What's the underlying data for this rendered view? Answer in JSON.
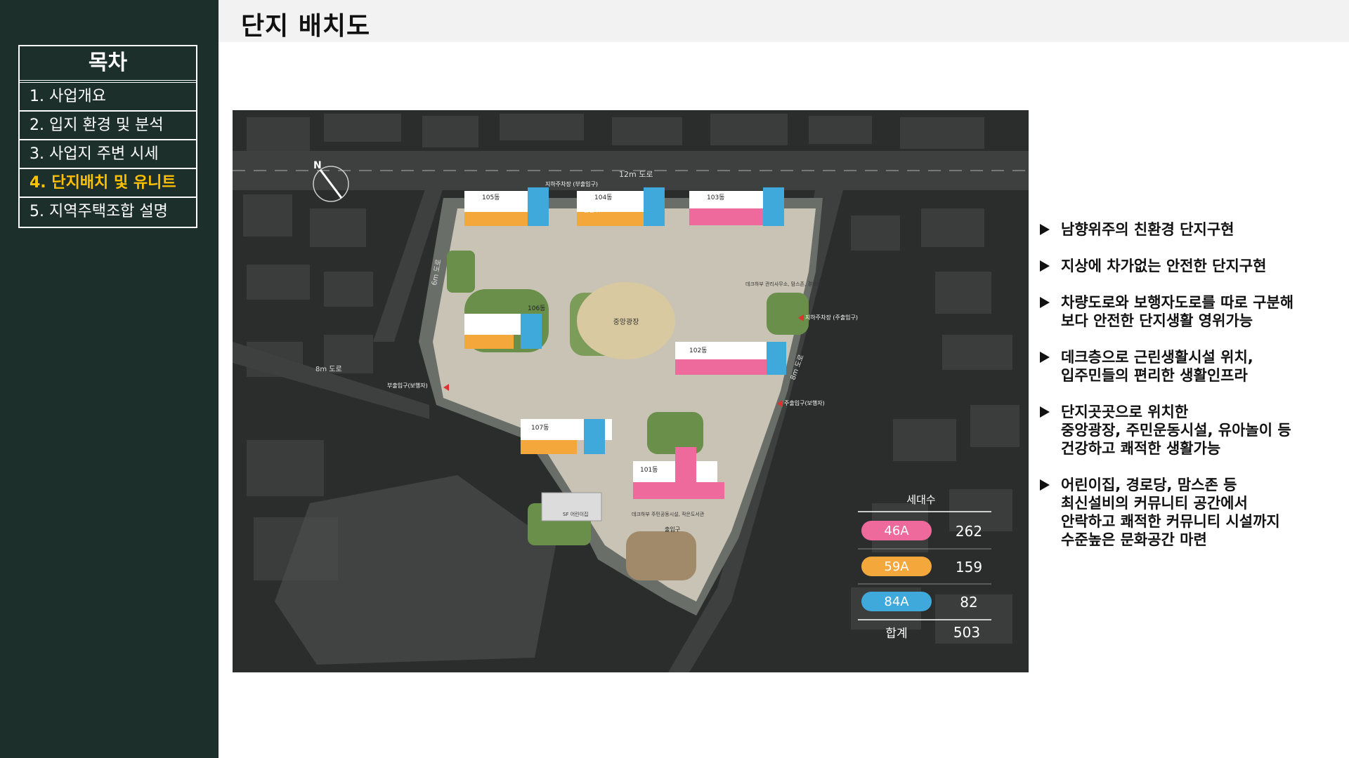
{
  "toc": {
    "title": "목차",
    "items": [
      {
        "label": "1. 사업개요",
        "active": false
      },
      {
        "label": "2. 입지 환경 및 분석",
        "active": false
      },
      {
        "label": "3. 사업지 주변 시세",
        "active": false
      },
      {
        "label": "4. 단지배치 및 유니트",
        "active": true
      },
      {
        "label": "5. 지역주택조합 설명",
        "active": false
      }
    ]
  },
  "header": {
    "title": "단지 배치도"
  },
  "siteplan": {
    "roads": {
      "north": "12m 도로",
      "west": "6m 도로",
      "southwest": "8m 도로",
      "east": "8m 도로"
    },
    "entrances": {
      "parking_top": "지하주차장 (부출입구)",
      "main_top": "출입구",
      "parking_east": "지하주차장 (주출입구)",
      "west_pedestrian": "부출입구(보행자)",
      "east_pedestrian": "주출입구(보행자)",
      "bottom_main": "출입구"
    },
    "buildings": [
      "105동",
      "104동",
      "103동",
      "106동",
      "102동",
      "107동",
      "101동"
    ],
    "plaza": "중앙광장",
    "facility_labels": {
      "north_community": "데크하부 관리사무소, 맘스존, 경비실",
      "daycare": "SF 어린이집",
      "community": "데크하부 주민공동시설, 작은도서관"
    },
    "north_arrow": "N",
    "unit_table": {
      "title": "세대수",
      "rows": [
        {
          "type": "46A",
          "count": "262",
          "color": "#ef6a9c"
        },
        {
          "type": "59A",
          "count": "159",
          "color": "#f4a73a"
        },
        {
          "type": "84A",
          "count": "82",
          "color": "#3fa9dc"
        }
      ],
      "total_label": "합계",
      "total_count": "503"
    }
  },
  "bullets": [
    {
      "lines": [
        "남향위주의 친환경 단지구현"
      ]
    },
    {
      "lines": [
        "지상에 차가없는 안전한 단지구현"
      ]
    },
    {
      "lines": [
        "차량도로와 보행자도로를 따로 구분해",
        "보다 안전한 단지생활 영위가능"
      ]
    },
    {
      "lines": [
        "데크층으로 근린생활시설 위치,",
        "입주민들의 편리한 생활인프라"
      ]
    },
    {
      "lines": [
        "단지곳곳으로 위치한",
        "중앙광장, 주민운동시설, 유아놀이 등",
        "건강하고 쾌적한 생활가능"
      ]
    },
    {
      "lines": [
        "어린이집, 경로당, 맘스존 등",
        "최신설비의 커뮤니티 공간에서",
        "안락하고 쾌적한 커뮤니티 시설까지",
        "수준높은 문화공간 마련"
      ]
    }
  ],
  "colors": {
    "sidebar": "#1c2f2b",
    "active": "#ffc000",
    "unit_46a": "#ef6a9c",
    "unit_59a": "#f4a73a",
    "unit_84a": "#3fa9dc"
  }
}
